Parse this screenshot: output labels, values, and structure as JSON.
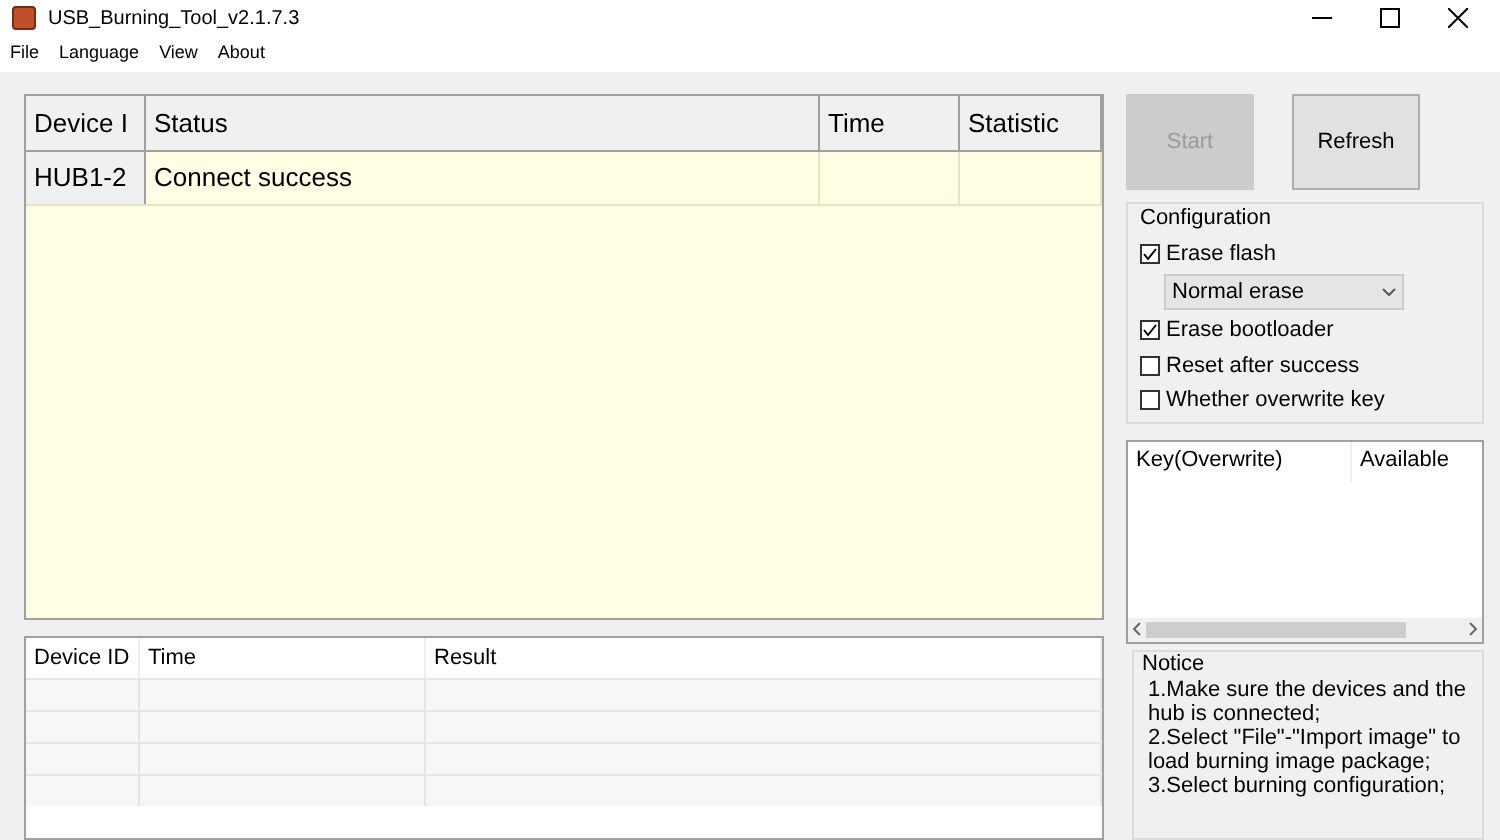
{
  "window": {
    "title": "USB_Burning_Tool_v2.1.7.3"
  },
  "menu": [
    "File",
    "Language",
    "View",
    "About"
  ],
  "device_table": {
    "columns": [
      "Device I",
      "Status",
      "Time",
      "Statistic"
    ],
    "rows": [
      {
        "cells": [
          "HUB1-2",
          "Connect success",
          "",
          ""
        ]
      }
    ]
  },
  "buttons": [
    {
      "label": "Start",
      "disabled": true
    },
    {
      "label": "Refresh",
      "disabled": false
    }
  ],
  "configuration": {
    "title": "Configuration",
    "options": [
      {
        "kind": "checkbox",
        "label": "Erase flash",
        "checked": true
      },
      {
        "kind": "select",
        "value": "Normal erase"
      },
      {
        "kind": "checkbox",
        "label": "Erase bootloader",
        "checked": true
      },
      {
        "kind": "checkbox",
        "label": "Reset after success",
        "checked": false
      },
      {
        "kind": "checkbox",
        "label": "Whether overwrite key",
        "checked": false
      }
    ]
  },
  "key_table": {
    "columns": [
      "Key(Overwrite)",
      "Available"
    ]
  },
  "result_table": {
    "columns": [
      "Device ID",
      "Time",
      "Result"
    ]
  },
  "notice": {
    "title": "Notice",
    "items": [
      "1.Make sure the devices and the hub is connected;",
      "2.Select \"File\"-\"Import image\" to load burning image package;",
      "3.Select burning configuration;"
    ]
  }
}
